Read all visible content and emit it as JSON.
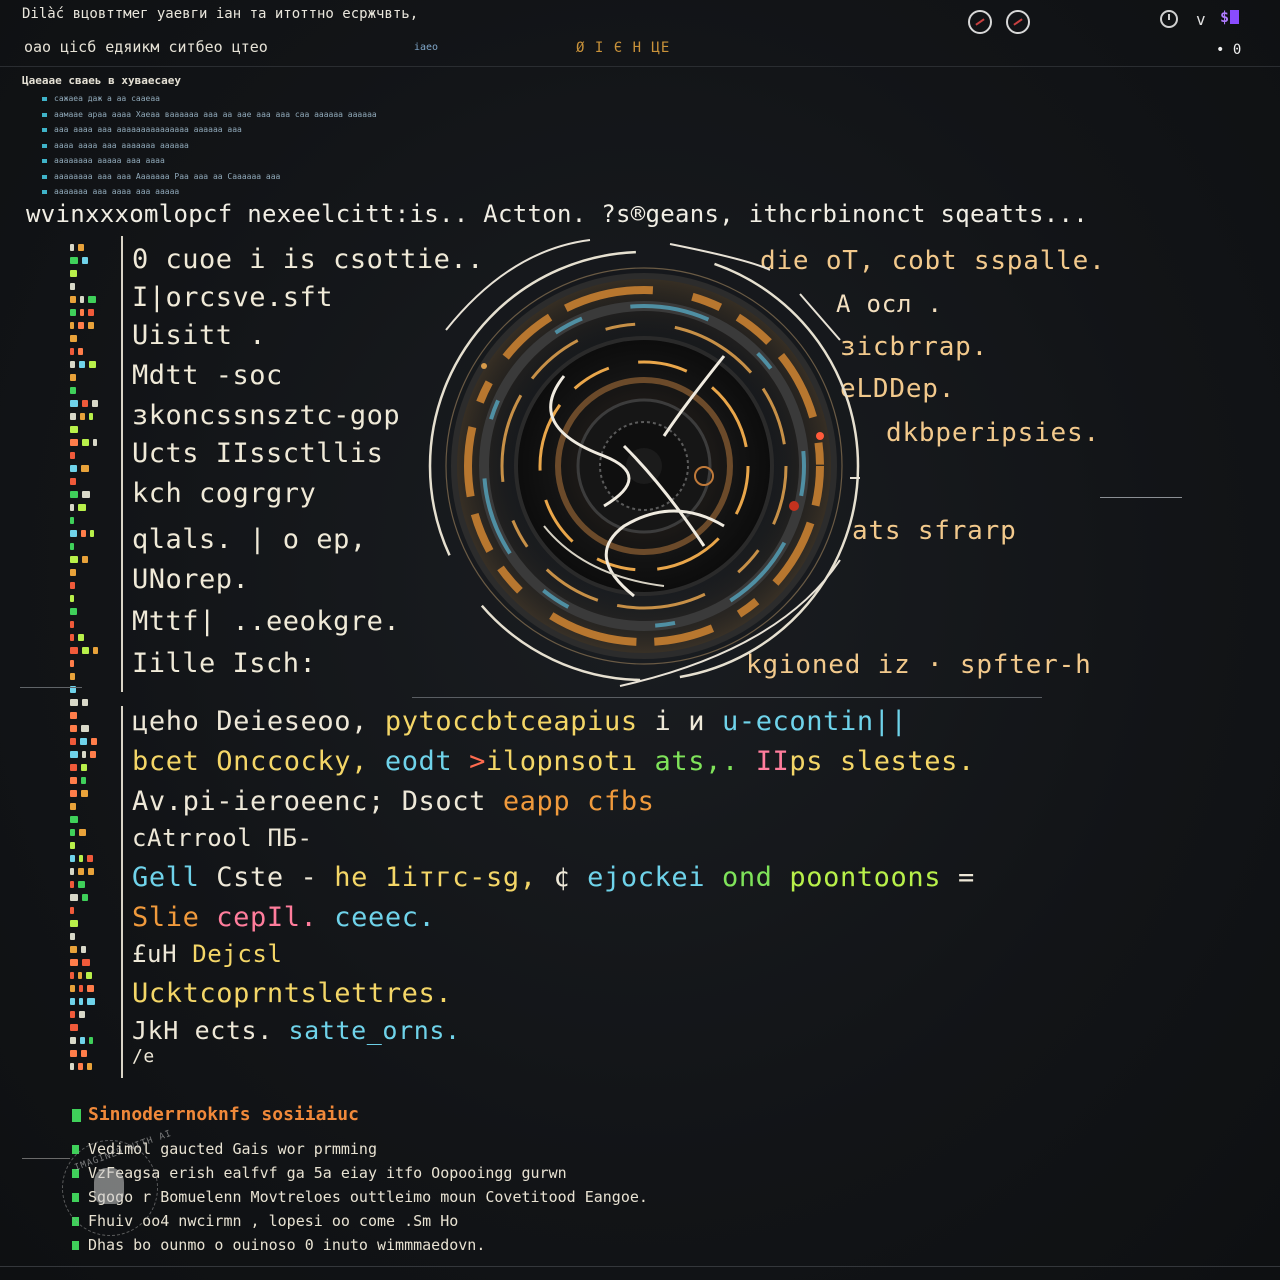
{
  "topbar": {
    "title": "Dilàć  вцовттмег уаевги іан  та  итоттно  есржчвть,",
    "subtitle": "оао   цісб  едяикм  ситбео  цтео",
    "tag_small": "іаео",
    "tag_orange": "Ø І Є Н ЦЕ",
    "tray_count": "• 0",
    "tray_badge": "$",
    "tray_chevron": "v"
  },
  "notes": {
    "heading": "Цаеаае  сваеь   в  хуваесаеу",
    "items": [
      "сажаеа   даж    а   аа  сааеаа",
      "аамаае  араа  аааа  Хаеаа  ваааааа  ааа  аа  аае  ааа  ааа  саа  аааааа  аааааа",
      "ааа  аааа  ааа  ааааааааааааааа  аааааа  ааа",
      "аааа   аааа  ааа  ааааааа  аааааа",
      "аааааааа  ааааа  ааа  аааа",
      "аааааааа   ааа  ааа  Ааааааа  Раа  ааа  аа  Саааааа  ааа",
      "ааааааа  ааа  аааа  ааа  ааааа"
    ]
  },
  "headline": "wvinxxxomlopcf  nexeelcitt:is..   Actton. ?s®geans, ithcrbinonct  sqeatts...",
  "code": [
    "0 cuoe  i  is   csottie..",
    "I|orcsve.sft",
    "Uisitt .",
    "Mdtt  -soc",
    "зkoncssnsztc-gop",
    "Ucts IIssctllis",
    "kch  cogrgry",
    "qlals. | o  ep,",
    "UNorep.",
    "Mttf| ..eeokgre.",
    "Iille Isch:"
  ],
  "right_labels": [
    "die  oT,  cobt  sspalle.",
    "A  oсл .",
    "зicbrrap.",
    "eLDDep.",
    "dkbperipsies.",
    "ats sfrarp",
    "kgioned  iz  ·  spfter-h"
  ],
  "lower": [
    {
      "segments": [
        [
          "c-white",
          "цeho  Deieseoo,  "
        ],
        [
          "c-yellow",
          "pytoccbtceapius"
        ],
        [
          "c-white",
          " i  "
        ],
        [
          "c-white",
          "и  "
        ],
        [
          "c-cyan",
          "u-econtin||"
        ]
      ]
    },
    {
      "segments": [
        [
          "c-yellow",
          "bcet  Onccocky,   "
        ],
        [
          "c-cyan",
          "eodt   "
        ],
        [
          "c-red",
          ">"
        ],
        [
          "c-yellow",
          "ilopnsotı  "
        ],
        [
          "c-green",
          "ats,.  "
        ],
        [
          "c-pink",
          "II"
        ],
        [
          "c-yellow",
          "ps "
        ],
        [
          "c-yellow",
          "slestes."
        ]
      ]
    },
    {
      "segments": [
        [
          "c-white",
          "Av.pi-ieroeenc;      "
        ],
        [
          "c-white",
          "Dsoct  "
        ],
        [
          "c-orange",
          "eapp   "
        ],
        [
          "c-orange",
          "cfbs"
        ]
      ]
    },
    {
      "segments": [
        [
          "c-white",
          "cAtrrool        "
        ],
        [
          "c-white",
          "ПБ-"
        ]
      ]
    },
    {
      "segments": [
        [
          "c-cyan",
          "Gell  "
        ],
        [
          "c-white",
          "Cste - "
        ],
        [
          "c-yellow",
          "he 1iтгс-sg,  "
        ],
        [
          "c-white",
          "¢  "
        ],
        [
          "c-cyan",
          "ejockei  "
        ],
        [
          "c-green",
          "ond  "
        ],
        [
          "c-lime",
          "poontoons "
        ],
        [
          "c-white",
          "="
        ]
      ]
    },
    {
      "segments": [
        [
          "c-orange",
          "Slie  "
        ],
        [
          "c-pink",
          "cepIl.  "
        ],
        [
          "c-cyan",
          "ceeec."
        ]
      ]
    },
    {
      "segments": [
        [
          "c-white",
          "£uH       "
        ],
        [
          "c-yellow",
          "Dejcsl"
        ]
      ]
    },
    {
      "segments": [
        [
          "c-yellow",
          "Ucktcoprntslettres."
        ]
      ]
    },
    {
      "segments": [
        [
          "c-white",
          "JkH  ects.     "
        ],
        [
          "c-cyan",
          "satte_orns."
        ]
      ]
    },
    {
      "segments": [
        [
          "c-white",
          "/e"
        ]
      ]
    }
  ],
  "footer": {
    "title": "Sinnoderrnoknfs  sosiiaiuc",
    "lines": [
      "Vedimol  gaucted  Gais  wor  prmming",
      "VzFeagsa  erish  ealfvf  ga  5a  eiay  itfo  Oopooingg  gurwn",
      "Sgogo  r  Bomuelenn  Movtreloes  outtleimo  moun  Covetitood  Eangoe.",
      "Fhuiv  oo4  nwcirmn , lopesi  oo  come  .Sm  Ho",
      "Dhas  bo  ounmo  o  ouinoso  0  inuto  wimmmaedovn."
    ]
  },
  "watermark": {
    "text": "IMAGINED WITH AI"
  },
  "colors": {
    "background": "#111316",
    "accent_orange": "#f09a3c",
    "accent_cyan": "#6fd3ea",
    "accent_green": "#3fd05a",
    "badge_purple": "#8a4cff"
  },
  "icons": [
    "close-circle-icon",
    "close-circle-icon",
    "clock-icon",
    "chevron-down-icon",
    "app-badge-icon",
    "watermark-logo-icon"
  ]
}
